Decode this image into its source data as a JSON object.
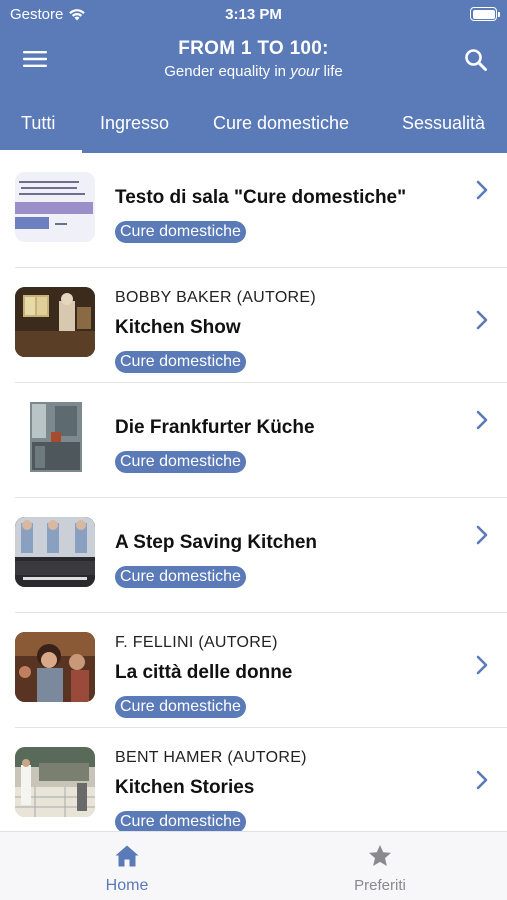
{
  "status": {
    "carrier": "Gestore",
    "time": "3:13 PM"
  },
  "header": {
    "title": "FROM 1 TO 100:",
    "subtitle_pre": "Gender equality in ",
    "subtitle_em": "your",
    "subtitle_post": " life"
  },
  "tabs": [
    "Tutti",
    "Ingresso",
    "Cure domestiche",
    "Sessualità"
  ],
  "items": [
    {
      "author": "",
      "title": "Testo di sala \"Cure domestiche\"",
      "tag": "Cure domestiche",
      "thumb_icon": "chart-thumbnail"
    },
    {
      "author": "BOBBY BAKER (AUTORE)",
      "title": "Kitchen Show",
      "tag": "Cure domestiche",
      "thumb_icon": "kitchen-photo-thumbnail"
    },
    {
      "author": "",
      "title": "Die Frankfurter Küche",
      "tag": "Cure domestiche",
      "thumb_icon": "kitchen-room-thumbnail"
    },
    {
      "author": "",
      "title": "A Step Saving Kitchen",
      "tag": "Cure domestiche",
      "thumb_icon": "film-still-thumbnail"
    },
    {
      "author": "F. FELLINI (AUTORE)",
      "title": "La città delle donne",
      "tag": "Cure domestiche",
      "thumb_icon": "film-still-thumbnail"
    },
    {
      "author": "BENT HAMER (AUTORE)",
      "title": "Kitchen Stories",
      "tag": "Cure domestiche",
      "thumb_icon": "film-still-thumbnail"
    }
  ],
  "bottom_nav": {
    "home": "Home",
    "favorites": "Preferiti"
  },
  "colors": {
    "accent": "#5a7ab8",
    "inactive": "#8a8a8e"
  }
}
